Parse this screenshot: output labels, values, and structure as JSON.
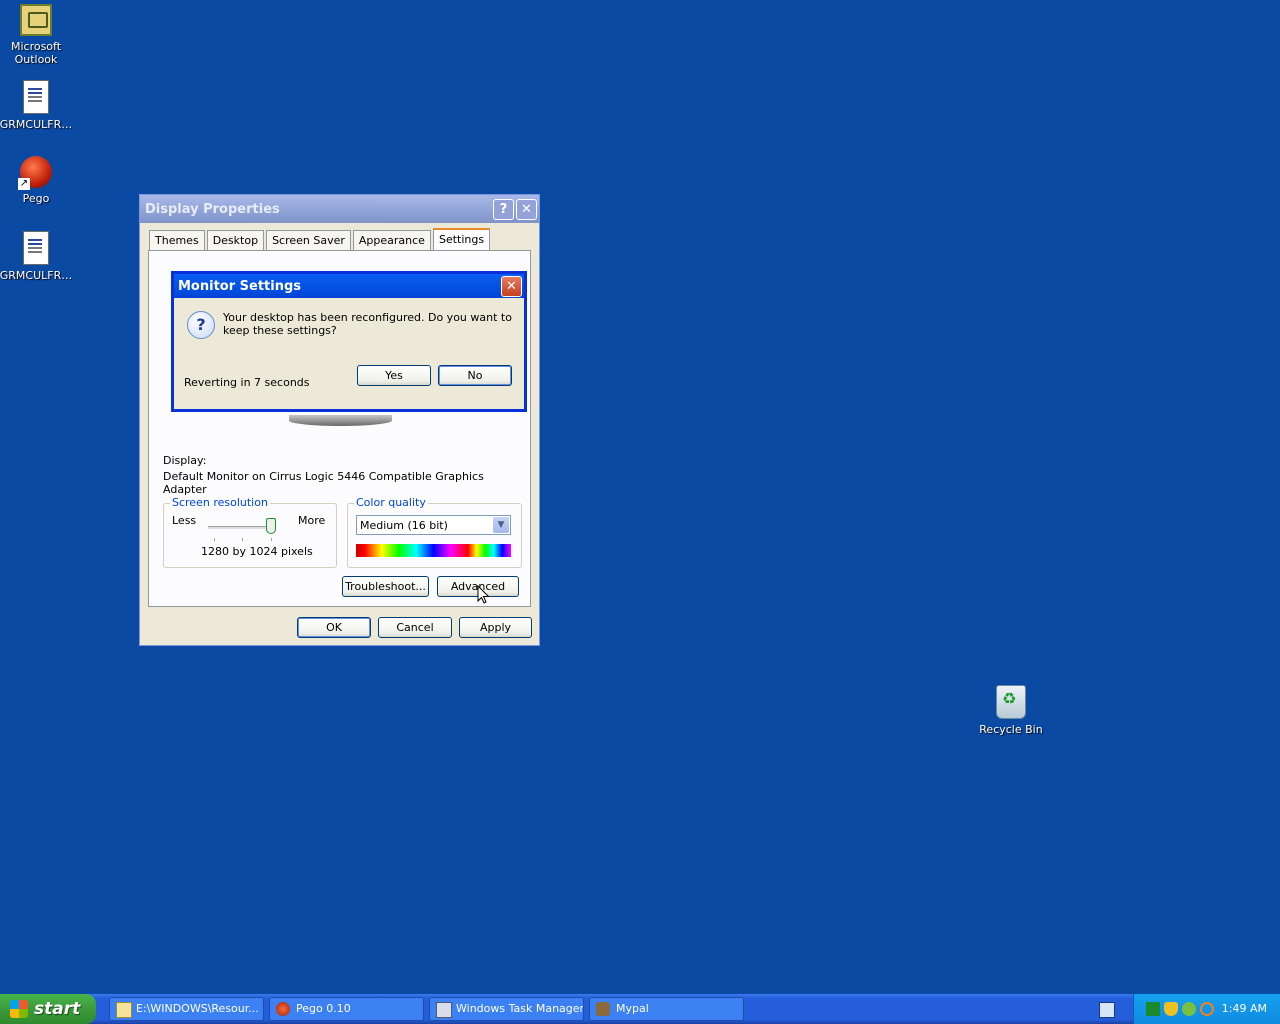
{
  "desktop": {
    "icons": [
      {
        "label_line1": "Microsoft",
        "label_line2": "Outlook"
      },
      {
        "label_line1": "GRMCULFR…"
      },
      {
        "label_line1": "Pego"
      },
      {
        "label_line1": "GRMCULFR…"
      },
      {
        "label_line1": "Recycle Bin"
      }
    ]
  },
  "display_properties": {
    "title": "Display Properties",
    "help_glyph": "?",
    "close_glyph": "✕",
    "tabs": [
      "Themes",
      "Desktop",
      "Screen Saver",
      "Appearance",
      "Settings"
    ],
    "display_label": "Display:",
    "display_value": "Default Monitor on Cirrus Logic 5446 Compatible Graphics Adapter",
    "resolution": {
      "title": "Screen resolution",
      "less": "Less",
      "more": "More",
      "value": "1280 by 1024 pixels",
      "slider_level": 1.0
    },
    "color_quality": {
      "title": "Color quality",
      "selected": "Medium (16 bit)",
      "arrow": "▼"
    },
    "troubleshoot": "Troubleshoot...",
    "advanced": "Advanced",
    "ok": "OK",
    "cancel": "Cancel",
    "apply": "Apply"
  },
  "monitor_dialog": {
    "title": "Monitor Settings",
    "close_glyph": "✕",
    "icon_glyph": "?",
    "message": "Your desktop has been reconfigured.  Do you want to keep these settings?",
    "countdown": "Reverting in 7 seconds",
    "yes": "Yes",
    "no": "No"
  },
  "taskbar": {
    "start": "start",
    "tasks": [
      {
        "label": "E:\\WINDOWS\\Resour..."
      },
      {
        "label": "Pego 0.10"
      },
      {
        "label": "Windows Task Manager"
      },
      {
        "label": "Mypal"
      }
    ],
    "clock": "1:49 AM"
  },
  "colors": {
    "desktop": "#0a4aa3",
    "taskbar": "#245edb",
    "dialog_border": "#0831d9",
    "start": "#3c9b3c"
  }
}
